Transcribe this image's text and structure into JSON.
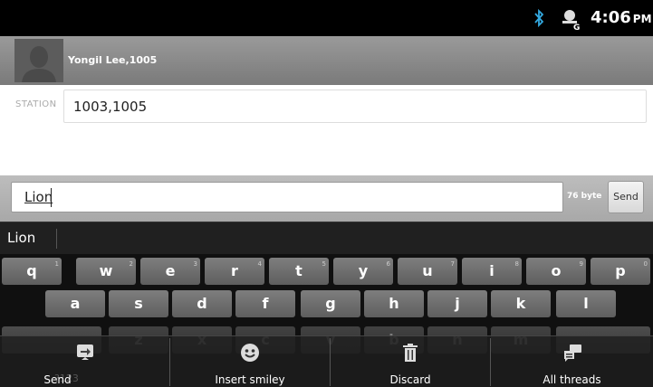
{
  "status_bar": {
    "time": "4:06",
    "ampm": "PM",
    "icons": [
      "bluetooth-icon",
      "gtalk-status-icon"
    ]
  },
  "contact": {
    "name": "Yongil Lee,1005"
  },
  "station": {
    "label": "STATION",
    "value": "1003,1005"
  },
  "compose": {
    "text": "Lion",
    "byte_count": "76 byte",
    "send_label": "Send"
  },
  "suggestions": {
    "word": "Lion"
  },
  "keyboard": {
    "row1": [
      {
        "key": "q",
        "hint": "1"
      },
      {
        "key": "w",
        "hint": "2"
      },
      {
        "key": "e",
        "hint": "3"
      },
      {
        "key": "r",
        "hint": "4"
      },
      {
        "key": "t",
        "hint": "5"
      },
      {
        "key": "y",
        "hint": "6"
      },
      {
        "key": "u",
        "hint": "7"
      },
      {
        "key": "i",
        "hint": "8"
      },
      {
        "key": "o",
        "hint": "9"
      },
      {
        "key": "p",
        "hint": "0"
      }
    ],
    "row2": [
      "a",
      "s",
      "d",
      "f",
      "g",
      "h",
      "j",
      "k",
      "l"
    ],
    "row3_faint": [
      "z",
      "x",
      "c",
      "v",
      "b",
      "n",
      "m"
    ],
    "symbols_label": "?123"
  },
  "menu": {
    "items": [
      {
        "label": "Send",
        "icon": "send-message-icon"
      },
      {
        "label": "Insert smiley",
        "icon": "smiley-icon"
      },
      {
        "label": "Discard",
        "icon": "trash-icon"
      },
      {
        "label": "All threads",
        "icon": "threads-icon"
      }
    ]
  }
}
